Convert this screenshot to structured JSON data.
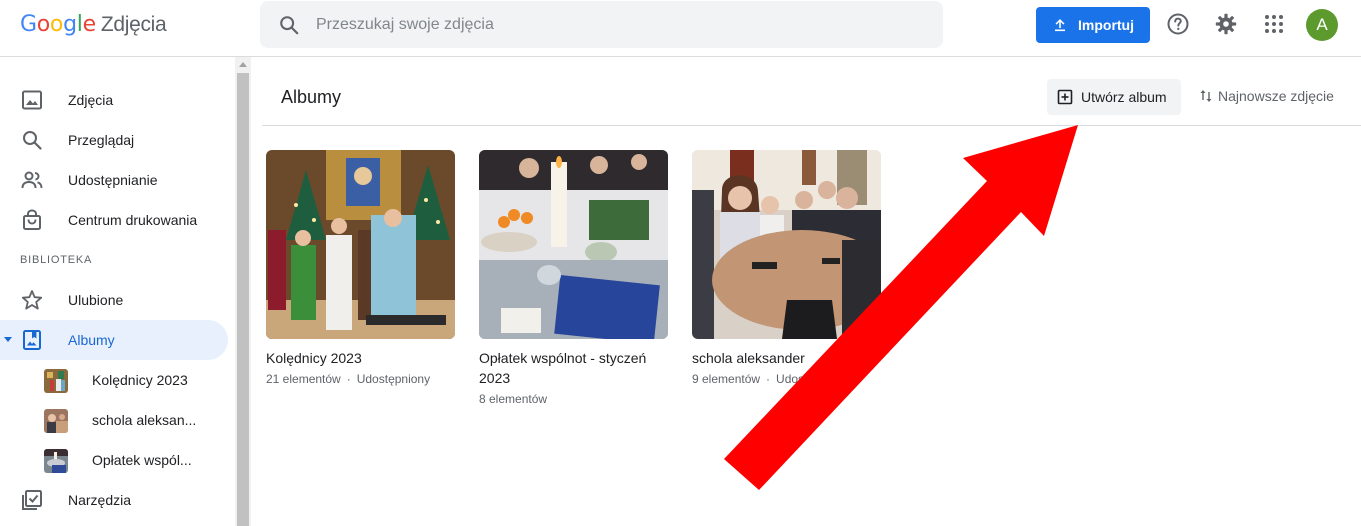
{
  "header": {
    "logo_word": [
      "G",
      "o",
      "o",
      "g",
      "l",
      "e"
    ],
    "product": "Zdjęcia",
    "search_placeholder": "Przeszukaj swoje zdjęcia",
    "import_label": "Importuj",
    "avatar_letter": "A",
    "icons": [
      "search-icon",
      "upload-icon",
      "help-icon",
      "settings-icon",
      "apps-grid-icon"
    ]
  },
  "sidebar": {
    "items": [
      {
        "label": "Zdjęcia",
        "icon": "photo-icon"
      },
      {
        "label": "Przeglądaj",
        "icon": "search-icon"
      },
      {
        "label": "Udostępnianie",
        "icon": "people-icon"
      },
      {
        "label": "Centrum drukowania",
        "icon": "shopping-bag-icon"
      }
    ],
    "section_label": "BIBLIOTEKA",
    "library": [
      {
        "label": "Ulubione",
        "icon": "star-icon"
      },
      {
        "label": "Albumy",
        "icon": "album-icon",
        "active": true
      }
    ],
    "albums": [
      {
        "label": "Kolędnicy 2023"
      },
      {
        "label": "schola aleksan..."
      },
      {
        "label": "Opłatek wspól..."
      }
    ],
    "tools": {
      "label": "Narzędzia",
      "icon": "checklist-icon"
    }
  },
  "main": {
    "title": "Albumy",
    "create_album": "Utwórz album",
    "sort_label": "Najnowsze zdjęcie",
    "albums": [
      {
        "title": "Kolędnicy 2023",
        "count": "21 elementów",
        "sep": "·",
        "shared": "Udostępniony"
      },
      {
        "title": "Opłatek wspólnot - styczeń 2023",
        "count": "8 elementów"
      },
      {
        "title": "schola aleksander",
        "count": "9 elementów",
        "sep": "·",
        "shared": "Udostępniony"
      }
    ]
  },
  "colors": {
    "accent": "#1a73e8",
    "active_bg": "#e8f0fe",
    "avatar": "#5c9a2d",
    "annotation_arrow": "#ff0000"
  }
}
